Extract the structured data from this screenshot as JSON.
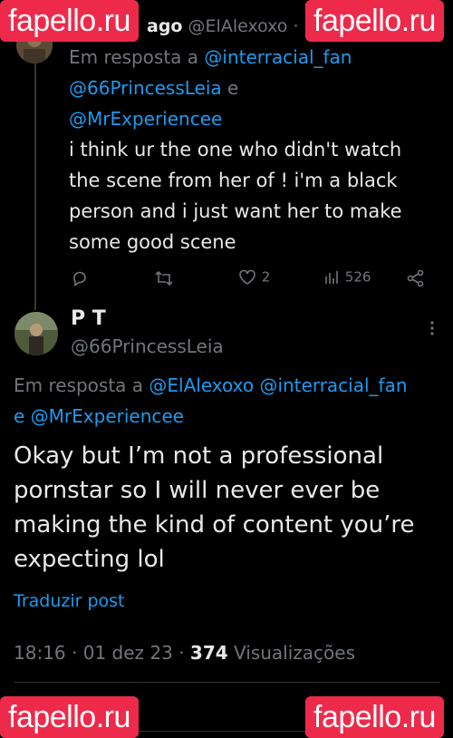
{
  "watermark": {
    "text": "fapello.ru",
    "bg": "#ee2a4b"
  },
  "parent_post": {
    "display_name": "ago",
    "handle": "@ElAlexoxo",
    "meta": "·",
    "reply_prefix": "Em resposta a",
    "mention_1": "@interracial_fan",
    "mention_2": "@66PrincessLeia",
    "conj": "e",
    "mention_3": "@MrExperiencee",
    "body_lines": [
      "i think ur the one who didn't watch",
      "the scene from her of  ! i'm a black",
      "person and i just want her to make",
      "some good scene"
    ],
    "likes": "2",
    "views": "526"
  },
  "main_post": {
    "display_name": "P T",
    "handle": "@66PrincessLeia",
    "reply_prefix": "Em resposta a",
    "mention_1": "@ElAlexoxo",
    "mention_2": "@interracial_fan",
    "conj": "e",
    "mention_3": "@MrExperiencee",
    "body_lines": [
      "Okay but I’m not a professional",
      "pornstar so I will never ever be",
      "making the kind of content you’re",
      "expecting lol"
    ],
    "translate": "Traduzir post",
    "time": "18:16",
    "sep": "·",
    "date": "01 dez 23",
    "view_count": "374",
    "view_label": "Visualizações"
  },
  "colors": {
    "accent": "#1d9bf0",
    "muted": "#71767b",
    "text": "#e7e9ea",
    "background": "#000000"
  }
}
